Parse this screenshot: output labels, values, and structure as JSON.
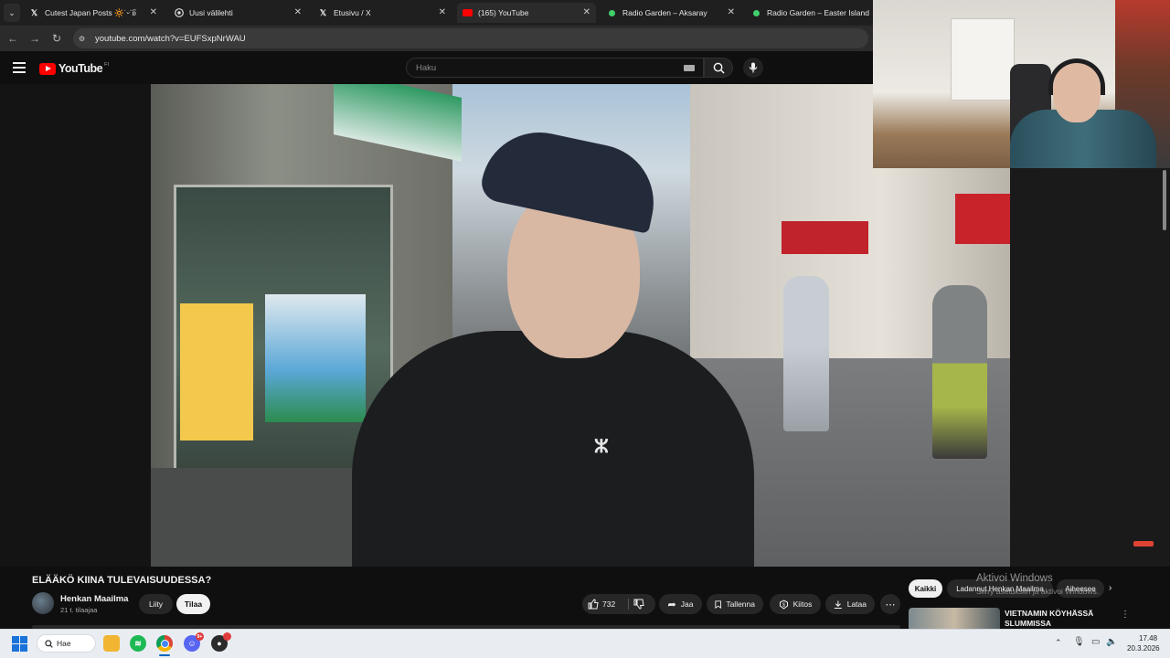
{
  "browser": {
    "tabs": [
      {
        "title": "Cutest Japan Posts 🔆˙ᵕ˙͡ʚ",
        "icon": "x-logo-icon"
      },
      {
        "title": "Uusi välilehti",
        "icon": "chrome-icon"
      },
      {
        "title": "Etusivu / X",
        "icon": "x-logo-icon"
      },
      {
        "title": "(165) YouTube",
        "icon": "youtube-icon"
      },
      {
        "title": "Radio Garden – Aksaray",
        "icon": "radio-garden-icon"
      },
      {
        "title": "Radio Garden – Easter Island",
        "icon": "radio-garden-icon"
      }
    ],
    "url": "youtube.com/watch?v=EUFSxpNrWAU"
  },
  "youtube": {
    "logo_text": "YouTube",
    "region": "FI",
    "search_placeholder": "Haku"
  },
  "video": {
    "title": "ELÄÄKÖ KIINA TULEVAISUUDESSA?",
    "channel_name": "Henkan Maailma",
    "subscribers": "21 t. tilaajaa",
    "join_label": "Liity",
    "subscribe_label": "Tilaa",
    "likes": "732",
    "share_label": "Jaa",
    "save_label": "Tallenna",
    "thanks_label": "Kiitos",
    "download_label": "Lataa",
    "more_label": "⋯"
  },
  "sidebar": {
    "chips": [
      "Kaikki",
      "Ladannut Henkan Maailma",
      "Aiheesee"
    ],
    "suggestion_title": "VIETNAMIN KÖYHÄSSÄ SLUMMISSA"
  },
  "watermark": {
    "title": "Aktivoi Windows",
    "subtitle": "Siirry asetuksiin ja aktivoi Windows."
  },
  "taskbar": {
    "search_label": "Hae",
    "time": "17.48",
    "date": "20.3.2026",
    "discord_badge": "9+"
  }
}
